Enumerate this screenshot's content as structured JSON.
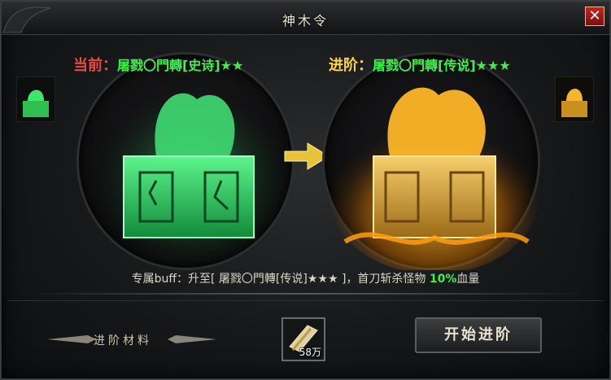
{
  "window": {
    "title": "神木令",
    "close_label": "✕"
  },
  "current": {
    "label": "当前：",
    "name": "屠戮〇門轉[史诗]★★"
  },
  "next": {
    "label": "进阶：",
    "name": "屠戮〇門轉[传说]★★★"
  },
  "buff": {
    "prefix": "专属buff：升至[",
    "target": "屠戮〇門轉[传说]★★★",
    "middle": "]，首刀斩杀怪物",
    "percent": "10%",
    "suffix": "血量"
  },
  "materials": {
    "label": "进阶材料",
    "item_count": "58万"
  },
  "actions": {
    "advance_label": "开始进阶"
  },
  "colors": {
    "current_glow": "#2fe86a",
    "next_glow": "#ffb21e",
    "highlight_text": "#3df04d"
  },
  "icons": [
    "close-icon",
    "jade-seal-icon",
    "golden-seal-icon",
    "arrow-right-icon",
    "material-scroll-icon"
  ]
}
